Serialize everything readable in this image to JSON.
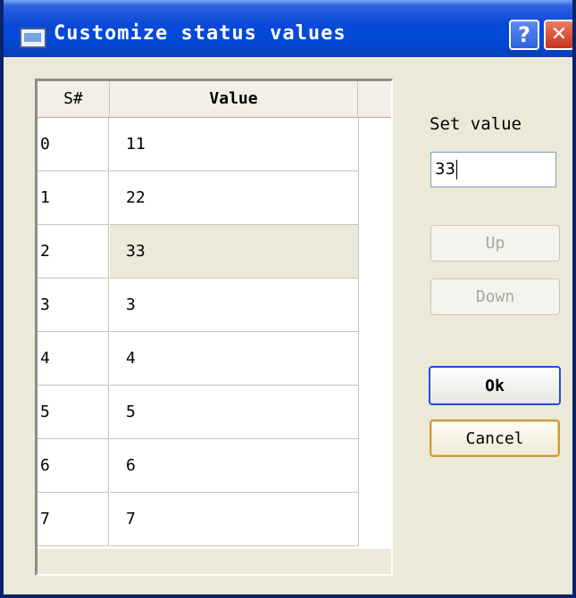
{
  "window": {
    "title": "Customize status values",
    "help_symbol": "?",
    "close_symbol": "✕"
  },
  "table": {
    "columns": [
      "S#",
      "Value"
    ],
    "rows": [
      {
        "sno": "0",
        "value": "11"
      },
      {
        "sno": "1",
        "value": "22"
      },
      {
        "sno": "2",
        "value": "33"
      },
      {
        "sno": "3",
        "value": "3"
      },
      {
        "sno": "4",
        "value": "4"
      },
      {
        "sno": "5",
        "value": "5"
      },
      {
        "sno": "6",
        "value": "6"
      },
      {
        "sno": "7",
        "value": "7"
      }
    ],
    "selected_index": 2
  },
  "controls": {
    "set_value_label": "Set value",
    "set_value_input": "33",
    "up_label": "Up",
    "down_label": "Down",
    "ok_label": "Ok",
    "cancel_label": "Cancel"
  }
}
